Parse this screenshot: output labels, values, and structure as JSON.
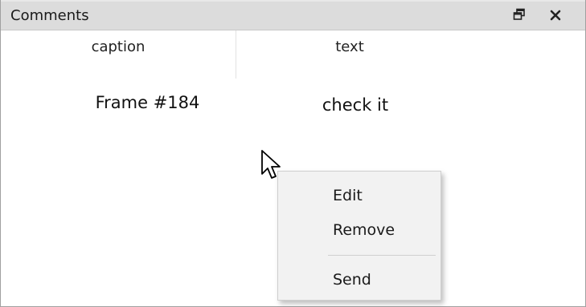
{
  "window": {
    "title": "Comments",
    "float_icon": "restore-float-icon",
    "close_icon": "close-icon"
  },
  "table": {
    "columns": [
      "caption",
      "text"
    ],
    "rows": [
      {
        "caption": "Frame #184",
        "text": "check it"
      }
    ]
  },
  "context_menu": {
    "items": [
      "Edit",
      "Remove",
      "Send"
    ]
  },
  "colors": {
    "titlebar": "#dcdcdc",
    "menu_bg": "#f2f2f2",
    "panel_bg": "#ffffff"
  }
}
